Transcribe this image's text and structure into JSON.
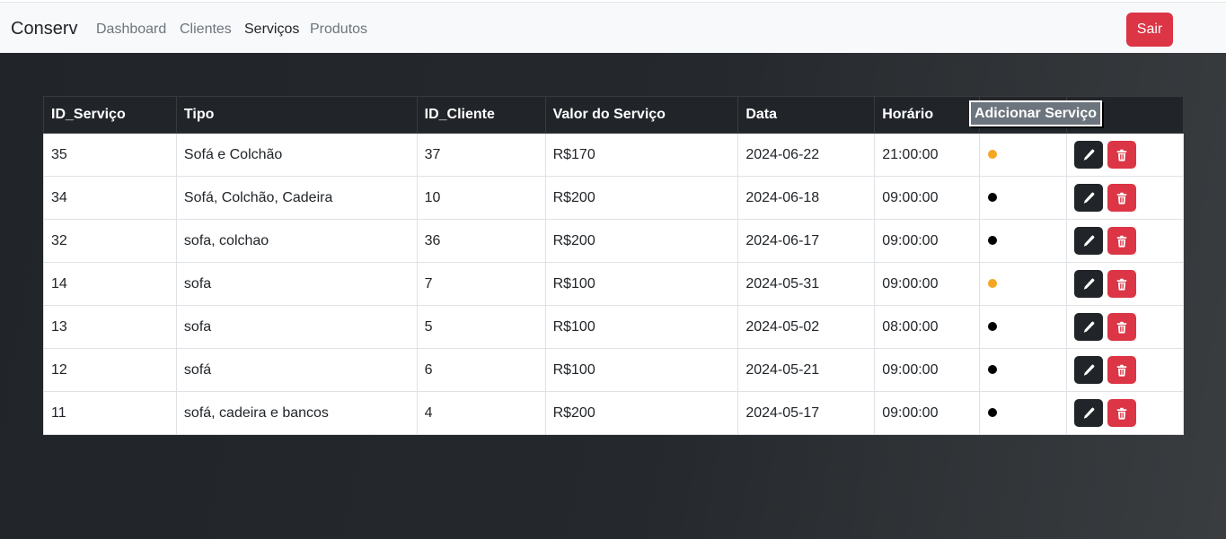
{
  "navbar": {
    "brand": "Conserv",
    "links": [
      "Dashboard",
      "Clientes",
      "Serviços",
      "Produtos"
    ],
    "logout_label": "Sair"
  },
  "table": {
    "headers": [
      "ID_Serviço",
      "Tipo",
      "ID_Cliente",
      "Valor do Serviço",
      "Data",
      "Horário"
    ],
    "add_button_label": "Adicionar Serviço",
    "rows": [
      {
        "id": "35",
        "tipo": "Sofá e Colchão",
        "id_cliente": "37",
        "valor": "R$170",
        "data": "2024-06-22",
        "horario": "21:00:00",
        "status_color": "#f5a623"
      },
      {
        "id": "34",
        "tipo": "Sofá, Colchão, Cadeira",
        "id_cliente": "10",
        "valor": "R$200",
        "data": "2024-06-18",
        "horario": "09:00:00",
        "status_color": "#000000"
      },
      {
        "id": "32",
        "tipo": "sofa, colchao",
        "id_cliente": "36",
        "valor": "R$200",
        "data": "2024-06-17",
        "horario": "09:00:00",
        "status_color": "#000000"
      },
      {
        "id": "14",
        "tipo": "sofa",
        "id_cliente": "7",
        "valor": "R$100",
        "data": "2024-05-31",
        "horario": "09:00:00",
        "status_color": "#f5a623"
      },
      {
        "id": "13",
        "tipo": "sofa",
        "id_cliente": "5",
        "valor": "R$100",
        "data": "2024-05-02",
        "horario": "08:00:00",
        "status_color": "#000000"
      },
      {
        "id": "12",
        "tipo": "sofá",
        "id_cliente": "6",
        "valor": "R$100",
        "data": "2024-05-21",
        "horario": "09:00:00",
        "status_color": "#000000"
      },
      {
        "id": "11",
        "tipo": "sofá, cadeira e bancos",
        "id_cliente": "4",
        "valor": "R$200",
        "data": "2024-05-17",
        "horario": "09:00:00",
        "status_color": "#000000"
      }
    ]
  },
  "icons": {
    "edit": "pencil-icon",
    "delete": "trash-icon"
  }
}
